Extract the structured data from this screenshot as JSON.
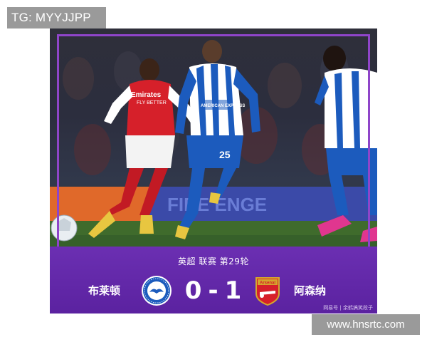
{
  "watermark_top": "TG: MYYJJPP",
  "watermark_bottom": "www.hnsrtc.com",
  "photo": {
    "sponsor_home_line1": "Emirates",
    "sponsor_home_line2": "FLY BETTER",
    "sponsor_away": "AMERICAN EXPRESS",
    "away_player_number": "25",
    "board_text": "FIRE    ENGE"
  },
  "match": {
    "competition": "英超 联赛 第29轮",
    "home_team": "布莱顿",
    "away_team": "阿森纳",
    "home_score": "0",
    "separator": "-",
    "away_score": "1",
    "home_badge_icon": "brighton-crest",
    "away_badge_icon": "arsenal-crest",
    "credit": "网易号 | 余鹤搞笑段子"
  },
  "colors": {
    "frame": "#8f45c9",
    "panel": "#5e24a3",
    "arsenal_red": "#d6202a",
    "brighton_blue": "#1c5bbd"
  }
}
